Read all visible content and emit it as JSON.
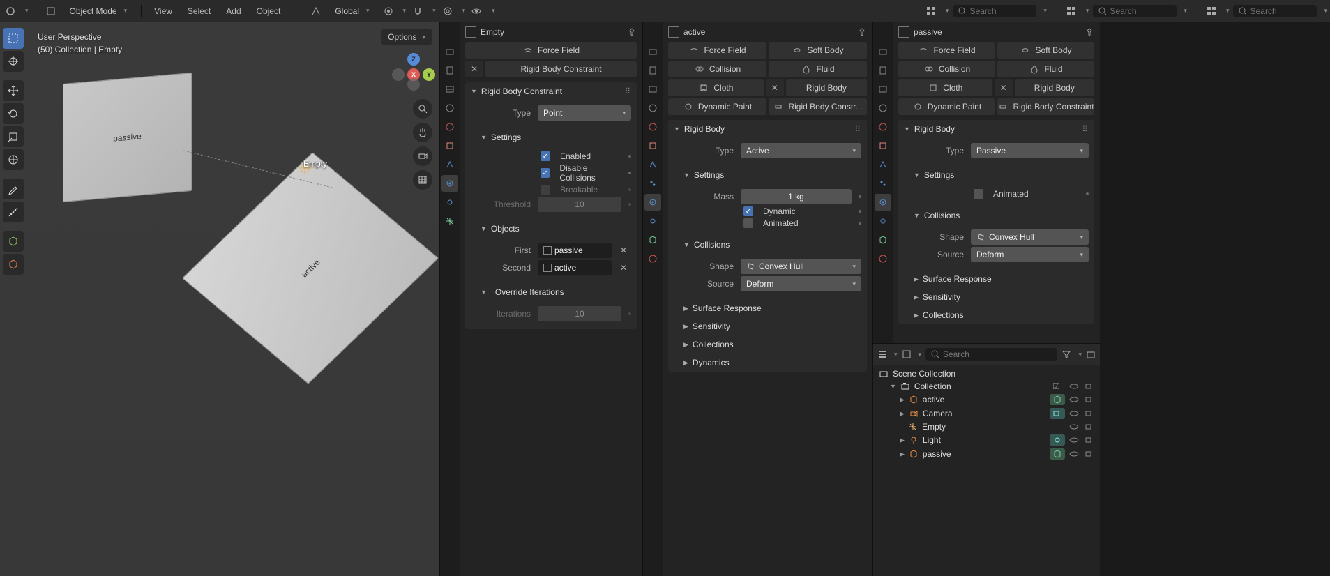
{
  "topbar": {
    "mode": "Object Mode",
    "view": "View",
    "select": "Select",
    "add": "Add",
    "object": "Object",
    "orientation": "Global",
    "options": "Options",
    "search_ph": "Search"
  },
  "viewport": {
    "info1": "User Perspective",
    "info2": "(50) Collection | Empty",
    "plane_passive": "passive",
    "plane_active": "active",
    "empty_label": "Empty",
    "axes": {
      "x": "X",
      "y": "Y",
      "z": "Z"
    }
  },
  "panel1": {
    "crumb": "Empty",
    "phys": {
      "force": "Force Field",
      "rigid": "Rigid Body Constraint"
    },
    "section": {
      "title": "Rigid Body Constraint",
      "type_label": "Type",
      "type_value": "Point",
      "settings": "Settings",
      "enabled": "Enabled",
      "disable_coll": "Disable Collisions",
      "breakable": "Breakable",
      "threshold_label": "Threshold",
      "threshold_value": "10",
      "objects": "Objects",
      "first_label": "First",
      "first_value": "passive",
      "second_label": "Second",
      "second_value": "active",
      "override": "Override Iterations",
      "iter_label": "Iterations",
      "iter_value": "10"
    }
  },
  "panel2": {
    "crumb": "active",
    "phys": {
      "force": "Force Field",
      "soft": "Soft Body",
      "collision": "Collision",
      "fluid": "Fluid",
      "cloth": "Cloth",
      "rigid": "Rigid Body",
      "dyn": "Dynamic Paint",
      "rbc": "Rigid Body Constr..."
    },
    "section": {
      "title": "Rigid Body",
      "type_label": "Type",
      "type_value": "Active",
      "settings": "Settings",
      "mass_label": "Mass",
      "mass_value": "1 kg",
      "dynamic": "Dynamic",
      "animated": "Animated",
      "collisions": "Collisions",
      "shape_label": "Shape",
      "shape_value": "Convex Hull",
      "source_label": "Source",
      "source_value": "Deform",
      "surf": "Surface Response",
      "sens": "Sensitivity",
      "colls": "Collections",
      "dyn": "Dynamics"
    }
  },
  "panel3": {
    "crumb": "passive",
    "phys": {
      "force": "Force Field",
      "soft": "Soft Body",
      "collision": "Collision",
      "fluid": "Fluid",
      "cloth": "Cloth",
      "rigid": "Rigid Body",
      "dyn": "Dynamic Paint",
      "rbc": "Rigid Body Constraint"
    },
    "section": {
      "title": "Rigid Body",
      "type_label": "Type",
      "type_value": "Passive",
      "settings": "Settings",
      "animated": "Animated",
      "collisions": "Collisions",
      "shape_label": "Shape",
      "shape_value": "Convex Hull",
      "source_label": "Source",
      "source_value": "Deform",
      "surf": "Surface Response",
      "sens": "Sensitivity",
      "colls": "Collections"
    }
  },
  "outliner": {
    "search_ph": "Search",
    "scene": "Scene Collection",
    "collection": "Collection",
    "items": {
      "active": "active",
      "camera": "Camera",
      "empty": "Empty",
      "light": "Light",
      "passive": "passive"
    }
  }
}
